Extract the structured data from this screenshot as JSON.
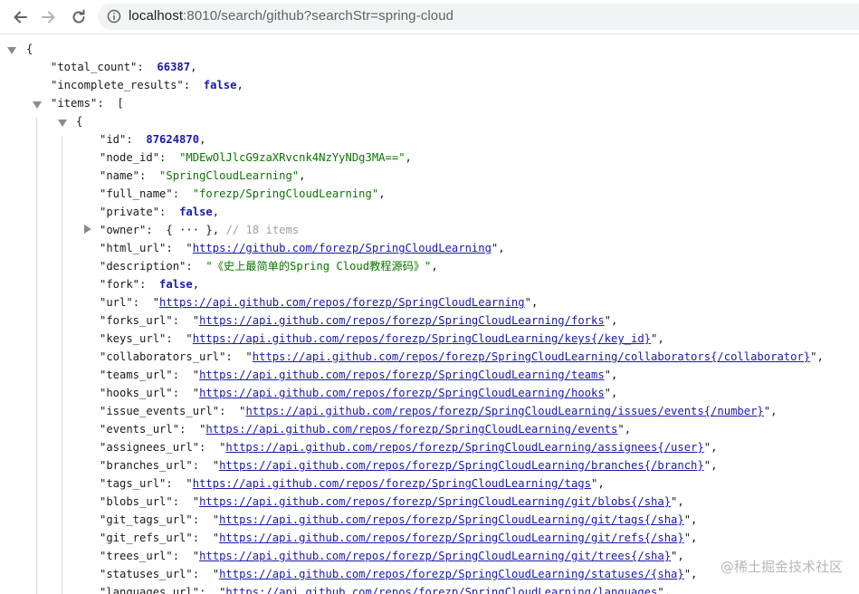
{
  "browser": {
    "url_host": "localhost",
    "url_rest": ":8010/search/github?searchStr=spring-cloud"
  },
  "json": {
    "open_brace": "{",
    "total_count_key": "\"total_count\"",
    "total_count": "66387",
    "incomplete_results_key": "\"incomplete_results\"",
    "incomplete_results": "false",
    "items_key": "\"items\"",
    "items_open": "[",
    "item_open": "{",
    "id_key": "\"id\"",
    "id": "87624870",
    "node_id_key": "\"node_id\"",
    "node_id": "\"MDEwOlJlcG9zaXRvcnk4NzYyNDg3MA==\"",
    "name_key": "\"name\"",
    "name": "\"SpringCloudLearning\"",
    "full_name_key": "\"full_name\"",
    "full_name": "\"forezp/SpringCloudLearning\"",
    "private_key": "\"private\"",
    "private": "false",
    "owner_key": "\"owner\"",
    "owner_collapsed": "{ ··· }",
    "owner_comment": "// 18 items",
    "html_url_key": "\"html_url\"",
    "html_url": "https://github.com/forezp/SpringCloudLearning",
    "description_key": "\"description\"",
    "description": "\"《史上最简单的Spring Cloud教程源码》\"",
    "fork_key": "\"fork\"",
    "fork": "false",
    "url_key": "\"url\"",
    "url": "https://api.github.com/repos/forezp/SpringCloudLearning",
    "forks_url_key": "\"forks_url\"",
    "forks_url": "https://api.github.com/repos/forezp/SpringCloudLearning/forks",
    "keys_url_key": "\"keys_url\"",
    "keys_url": "https://api.github.com/repos/forezp/SpringCloudLearning/keys{/key_id}",
    "collaborators_url_key": "\"collaborators_url\"",
    "collaborators_url": "https://api.github.com/repos/forezp/SpringCloudLearning/collaborators{/collaborator}",
    "teams_url_key": "\"teams_url\"",
    "teams_url": "https://api.github.com/repos/forezp/SpringCloudLearning/teams",
    "hooks_url_key": "\"hooks_url\"",
    "hooks_url": "https://api.github.com/repos/forezp/SpringCloudLearning/hooks",
    "issue_events_url_key": "\"issue_events_url\"",
    "issue_events_url": "https://api.github.com/repos/forezp/SpringCloudLearning/issues/events{/number}",
    "events_url_key": "\"events_url\"",
    "events_url": "https://api.github.com/repos/forezp/SpringCloudLearning/events",
    "assignees_url_key": "\"assignees_url\"",
    "assignees_url": "https://api.github.com/repos/forezp/SpringCloudLearning/assignees{/user}",
    "branches_url_key": "\"branches_url\"",
    "branches_url": "https://api.github.com/repos/forezp/SpringCloudLearning/branches{/branch}",
    "tags_url_key": "\"tags_url\"",
    "tags_url": "https://api.github.com/repos/forezp/SpringCloudLearning/tags",
    "blobs_url_key": "\"blobs_url\"",
    "blobs_url": "https://api.github.com/repos/forezp/SpringCloudLearning/git/blobs{/sha}",
    "git_tags_url_key": "\"git_tags_url\"",
    "git_tags_url": "https://api.github.com/repos/forezp/SpringCloudLearning/git/tags{/sha}",
    "git_refs_url_key": "\"git_refs_url\"",
    "git_refs_url": "https://api.github.com/repos/forezp/SpringCloudLearning/git/refs{/sha}",
    "trees_url_key": "\"trees_url\"",
    "trees_url": "https://api.github.com/repos/forezp/SpringCloudLearning/git/trees{/sha}",
    "statuses_url_key": "\"statuses_url\"",
    "statuses_url": "https://api.github.com/repos/forezp/SpringCloudLearning/statuses/{sha}",
    "languages_url_key": "\"languages_url\"",
    "languages_url": "https://api.github.com/repos/forezp/SpringCloudLearning/languages"
  },
  "watermark": "@稀土掘金技术社区",
  "icons": {
    "back": "back-arrow-icon",
    "forward": "forward-arrow-icon",
    "reload": "reload-icon",
    "info": "info-icon"
  },
  "colors": {
    "number": "#1a1aa6",
    "string": "#0b7500",
    "comment": "#a0a0a0"
  }
}
